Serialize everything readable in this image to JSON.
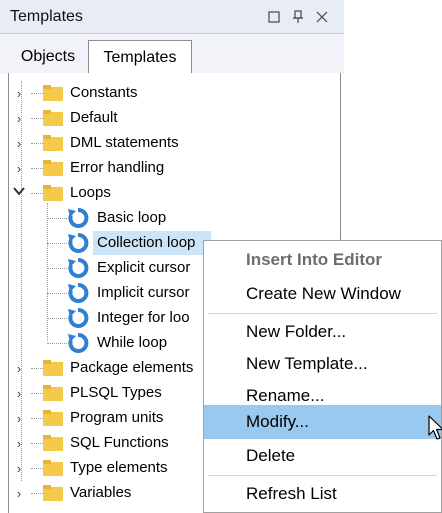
{
  "window": {
    "title": "Templates",
    "icons": [
      "maximize-icon",
      "pin-icon",
      "close-icon"
    ]
  },
  "tabs": [
    {
      "label": "Objects",
      "active": false
    },
    {
      "label": "Templates",
      "active": true
    }
  ],
  "tree": {
    "folders_top": [
      "Constants",
      "Default",
      "DML statements",
      "Error handling"
    ],
    "expanded_folder": "Loops",
    "loop_children": [
      "Basic loop",
      "Collection loop",
      "Explicit cursor",
      "Implicit cursor",
      "Integer for loo",
      "While loop"
    ],
    "selected_child": "Collection loop",
    "folders_bottom": [
      "Package elements",
      "PLSQL Types",
      "Program units",
      "SQL Functions",
      "Type elements",
      "Variables"
    ]
  },
  "context_menu": {
    "items": [
      {
        "label": "Insert Into Editor",
        "state": "disabled-bold"
      },
      {
        "label": "Create New Window",
        "state": "normal"
      },
      {
        "label": "New Folder...",
        "state": "normal"
      },
      {
        "label": "New Template...",
        "state": "normal"
      },
      {
        "label": "Rename...",
        "state": "normal"
      },
      {
        "label": "Modify...",
        "state": "hover"
      },
      {
        "label": "Delete",
        "state": "normal"
      },
      {
        "label": "Refresh List",
        "state": "normal"
      }
    ]
  },
  "colors": {
    "titlebar": "#e7ecf6",
    "selection": "#cce4f7",
    "menu_hover": "#99c9ef",
    "folder": "#f5c94a",
    "loop_icon": "#2f7fd3"
  }
}
